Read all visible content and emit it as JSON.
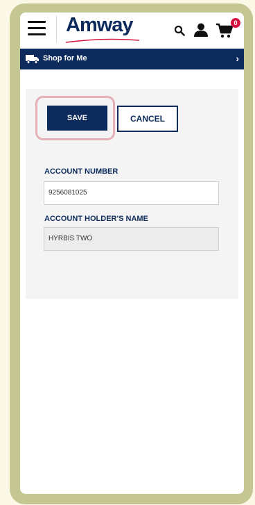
{
  "header": {
    "logo_text": "Amway",
    "cart_count": "0"
  },
  "shop_bar": {
    "label_prefix": "Shop for",
    "label_me": "Me",
    "chevron": "›"
  },
  "form": {
    "save_label": "SAVE",
    "cancel_label": "CANCEL",
    "account_number_label": "ACCOUNT NUMBER",
    "account_number_value": "9256081025",
    "account_holder_label": "ACCOUNT HOLDER'S NAME",
    "account_holder_value": "HYRBIS TWO"
  },
  "colors": {
    "brand_navy": "#0c2a5b",
    "frame_olive": "#c4c792",
    "highlight_pink": "#e3b1b7",
    "badge_red": "#d51640"
  },
  "icons": [
    "hamburger-menu-icon",
    "search-icon",
    "user-icon",
    "cart-icon",
    "delivery-truck-icon",
    "chevron-right-icon"
  ]
}
